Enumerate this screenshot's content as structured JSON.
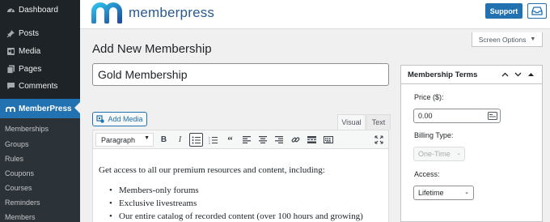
{
  "sidebar": {
    "items": [
      {
        "label": "Dashboard",
        "icon": "dashboard-icon"
      },
      {
        "label": "Posts",
        "icon": "pin-icon"
      },
      {
        "label": "Media",
        "icon": "media-icon"
      },
      {
        "label": "Pages",
        "icon": "pages-icon"
      },
      {
        "label": "Comments",
        "icon": "comments-icon"
      },
      {
        "label": "MemberPress",
        "icon": "memberpress-icon",
        "active": true
      }
    ],
    "submenu": [
      "Memberships",
      "Groups",
      "Rules",
      "Coupons",
      "Courses",
      "Reminders",
      "Members"
    ]
  },
  "header": {
    "brand": "memberpress",
    "support_label": "Support",
    "inbox_icon": "inbox-icon"
  },
  "screen_options": {
    "label": "Screen Options"
  },
  "page_title": "Add New Membership",
  "title_input": {
    "value": "Gold Membership"
  },
  "editor": {
    "add_media_label": "Add Media",
    "tabs": {
      "visual": "Visual",
      "text": "Text"
    },
    "format_select": "Paragraph",
    "intro": "Get access to all our premium resources and content, including:",
    "bullets": [
      "Members-only forums",
      "Exclusive livestreams",
      "Our entire catalog of recorded content (over 100 hours and growing)"
    ]
  },
  "terms_box": {
    "title": "Membership Terms",
    "price_label": "Price ($):",
    "price_value": "0.00",
    "billing_label": "Billing Type:",
    "billing_value": "One-Time",
    "access_label": "Access:",
    "access_value": "Lifetime"
  },
  "colors": {
    "sidebar_bg": "#1d2327",
    "accent": "#2271b1",
    "brand_text": "#2a5990"
  }
}
